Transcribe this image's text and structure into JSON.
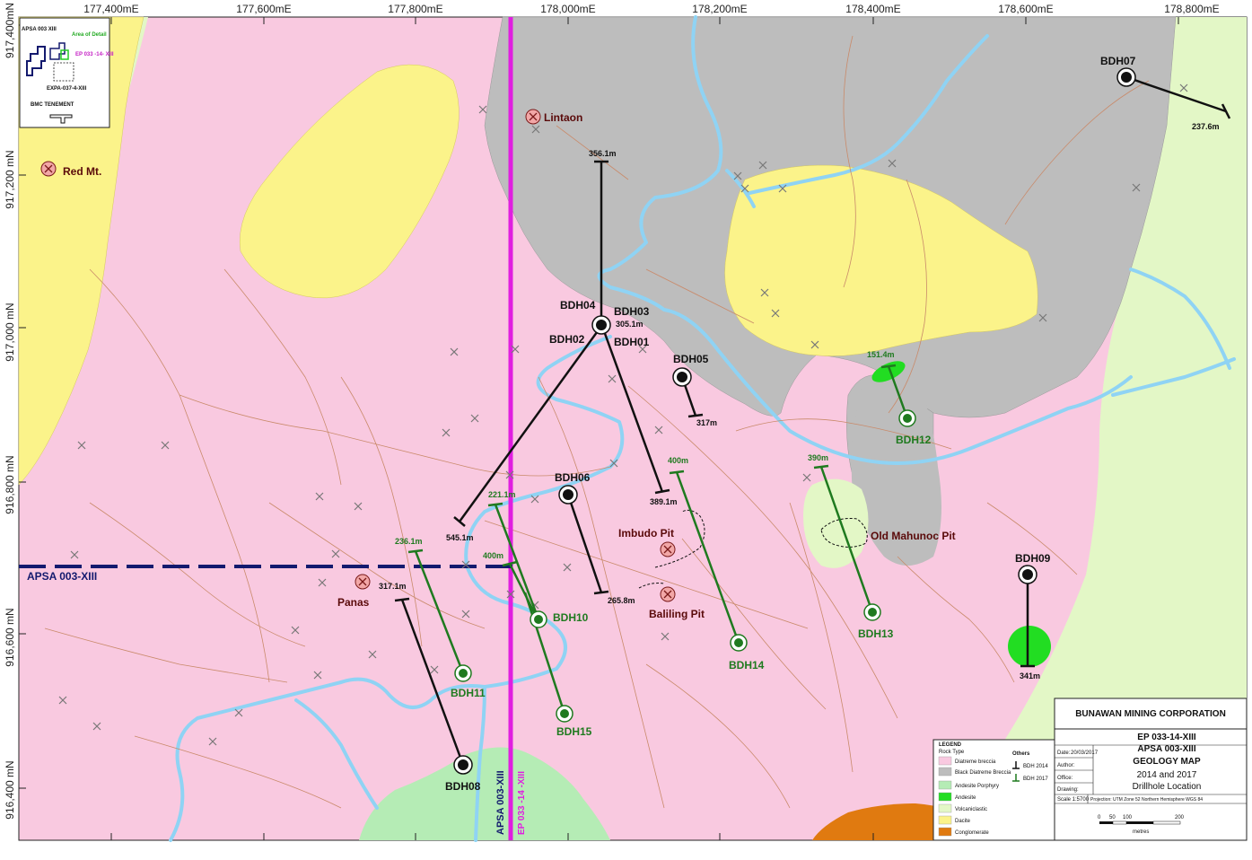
{
  "grid": {
    "easting_labels": [
      "177,400mE",
      "177,600mE",
      "177,800mE",
      "178,000mE",
      "178,200mE",
      "178,400mE",
      "178,600mE",
      "178,800mE"
    ],
    "northing_labels": [
      "917,400mN",
      "917,200 mN",
      "917,000 mN",
      "916,800 mN",
      "916,600 mN",
      "916,400 mN"
    ]
  },
  "inset": {
    "apsa_label": "APSA 003 XIII",
    "area_label": "Area of Detail",
    "ep_label": "EP 033 -14- XIII",
    "expa_label": "EXPA-037-4-XIII",
    "tenement_label": "BMC TENEMENT"
  },
  "sites": {
    "lintaon": "Lintaon",
    "red_mt": "Red Mt.",
    "panas": "Panas",
    "imbudo": "Imbudo Pit",
    "baliling": "Baliling Pit",
    "old_mahunoc": "Old Mahunoc Pit"
  },
  "boundaries": {
    "apsa_horizontal": "APSA 003-XIII",
    "apsa_vertical": "APSA 003-XIII",
    "ep_vertical": "EP 033 -14 -XIII"
  },
  "drillholes_2014": [
    {
      "id": "BDH07",
      "depth": "237.6m"
    },
    {
      "id": "BDH04",
      "depth": "356.1m"
    },
    {
      "id": "BDH03",
      "depth": "305.1m"
    },
    {
      "id": "BDH02",
      "depth": "545.1m"
    },
    {
      "id": "BDH01",
      "depth": "389.1m"
    },
    {
      "id": "BDH05",
      "depth": "317m"
    },
    {
      "id": "BDH06",
      "depth": "265.8m"
    },
    {
      "id": "BDH08",
      "depth": "317.1m"
    },
    {
      "id": "BDH09",
      "depth": "341m"
    }
  ],
  "drillholes_2017": [
    {
      "id": "BDH10",
      "depth": "221.1m"
    },
    {
      "id": "BDH10_extra",
      "depth": "400m"
    },
    {
      "id": "BDH11",
      "depth": "236.1m"
    },
    {
      "id": "BDH12",
      "depth": "151.4m"
    },
    {
      "id": "BDH13",
      "depth": "390m"
    },
    {
      "id": "BDH14",
      "depth": "400m"
    },
    {
      "id": "BDH15",
      "depth": ""
    }
  ],
  "hole_labels": {
    "BDH07": "BDH07",
    "BDH04": "BDH04",
    "BDH03": "BDH03",
    "BDH02": "BDH02",
    "BDH01": "BDH01",
    "BDH05": "BDH05",
    "BDH06": "BDH06",
    "BDH08": "BDH08",
    "BDH09": "BDH09",
    "BDH10": "BDH10",
    "BDH11": "BDH11",
    "BDH12": "BDH12",
    "BDH13": "BDH13",
    "BDH14": "BDH14",
    "BDH15": "BDH15"
  },
  "legend": {
    "title": "LEGEND",
    "subtitle": "Rock Type",
    "items": [
      {
        "label": "Diatreme breccia",
        "color": "#f9c9e0"
      },
      {
        "label": "Black Diatreme Breccia",
        "color": "#bdbdbd"
      },
      {
        "label": "Andesite Porphyry",
        "color": "#b5ecb5"
      },
      {
        "label": "Andesite",
        "color": "#22dd22"
      },
      {
        "label": "Volcaniclastic",
        "color": "#e3f7c6"
      },
      {
        "label": "Dacite",
        "color": "#fbf38a"
      },
      {
        "label": "Conglomerate",
        "color": "#e07a10"
      }
    ],
    "others_title": "Others",
    "others": [
      {
        "label": "BDH 2014",
        "color": "#111111"
      },
      {
        "label": "BDH 2017",
        "color": "#1f7a1f"
      }
    ]
  },
  "title_block": {
    "company": "BUNAWAN MINING CORPORATION",
    "line1": "EP 033-14-XIII",
    "line2": "APSA 003-XIII",
    "line3": "GEOLOGY MAP",
    "line4": "2014 and 2017",
    "line5": "Drillhole Location",
    "date_label": "Date:",
    "date_value": "20/03/2017",
    "author_label": "Author:",
    "office_label": "Office:",
    "drawing_label": "Drawing:",
    "scale": "Scale 1:5700",
    "projection": "Projection: UTM Zone 52 Northern Hemisphere WGS 84",
    "scalebar_labels": [
      "0",
      "50",
      "100",
      "200"
    ],
    "scalebar_unit": "metres"
  },
  "colors": {
    "diatreme": "#f9c9e0",
    "black_diatreme": "#bdbdbd",
    "dacite": "#fbf38a",
    "volcaniclastic": "#e3f7c6",
    "andesite_porphyry": "#b5ecb5",
    "andesite": "#22dd22",
    "conglomerate": "#e07a10",
    "river": "#8fd3f4",
    "road": "#c98a6a",
    "boundary_ep": "#e01ee0",
    "boundary_apsa": "#131a6e",
    "hole_2017": "#1f7a1f"
  }
}
